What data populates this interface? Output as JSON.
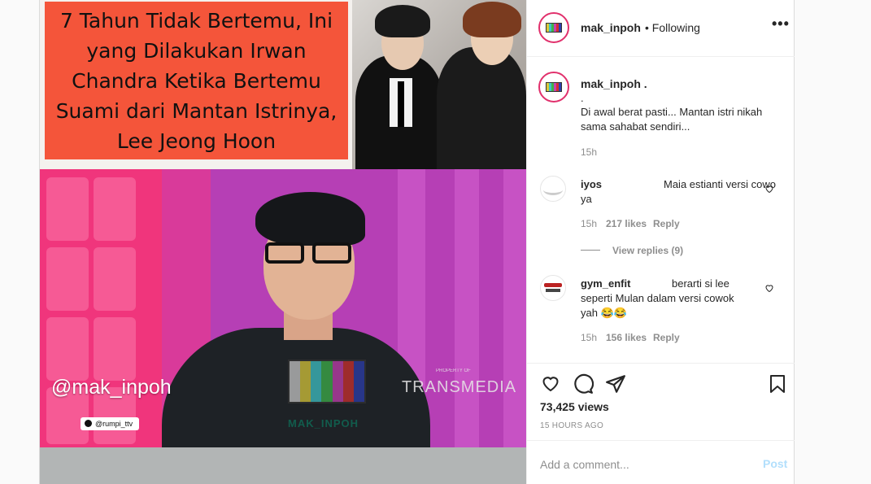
{
  "media": {
    "headline": "7 Tahun Tidak Bertemu, Ini yang Dilakukan Irwan Chandra Ketika Bertemu Suami dari Mantan Istrinya, Lee Jeong Hoon",
    "headline_bg": "#f4553a",
    "watermark_handle": "@mak_inpoh",
    "small_tag": "@rumpi_ttv",
    "channel_logo_text": "MAK_INPOH",
    "broadcaster_text": "TRANSMEDIA",
    "broadcaster_small": "PROPERTY OF"
  },
  "header": {
    "username": "mak_inpoh",
    "follow_status": "• Following",
    "more_icon": "more-options-icon"
  },
  "caption": {
    "username": "mak_inpoh .",
    "lines": [
      ".",
      "Di awal berat pasti... Mantan istri nikah",
      "sama sahabat sendiri..."
    ],
    "time": "15h"
  },
  "comments": [
    {
      "username": "iyos",
      "text_line1": "Maia estianti versi cowo",
      "text_line2": "ya",
      "time": "15h",
      "likes": "217 likes",
      "reply": "Reply",
      "view_replies": "View replies (9)"
    },
    {
      "username": "gym_enfit",
      "text_line1": "berarti si lee",
      "text_line2": "seperti Mulan dalam versi cowok",
      "text_line3": "yah 😂😂",
      "time": "15h",
      "likes": "156 likes",
      "reply": "Reply"
    }
  ],
  "actions": {
    "like_icon": "heart-icon",
    "comment_icon": "comment-icon",
    "share_icon": "share-icon",
    "save_icon": "bookmark-icon"
  },
  "stats": {
    "views": "73,425 views",
    "posted_ago": "15 HOURS AGO"
  },
  "comment_input": {
    "placeholder": "Add a comment...",
    "post_label": "Post"
  },
  "colors": {
    "accent_link": "#b2dffc",
    "avatar_ring": "#e1306c",
    "secondary_text": "#8e8e8e"
  }
}
